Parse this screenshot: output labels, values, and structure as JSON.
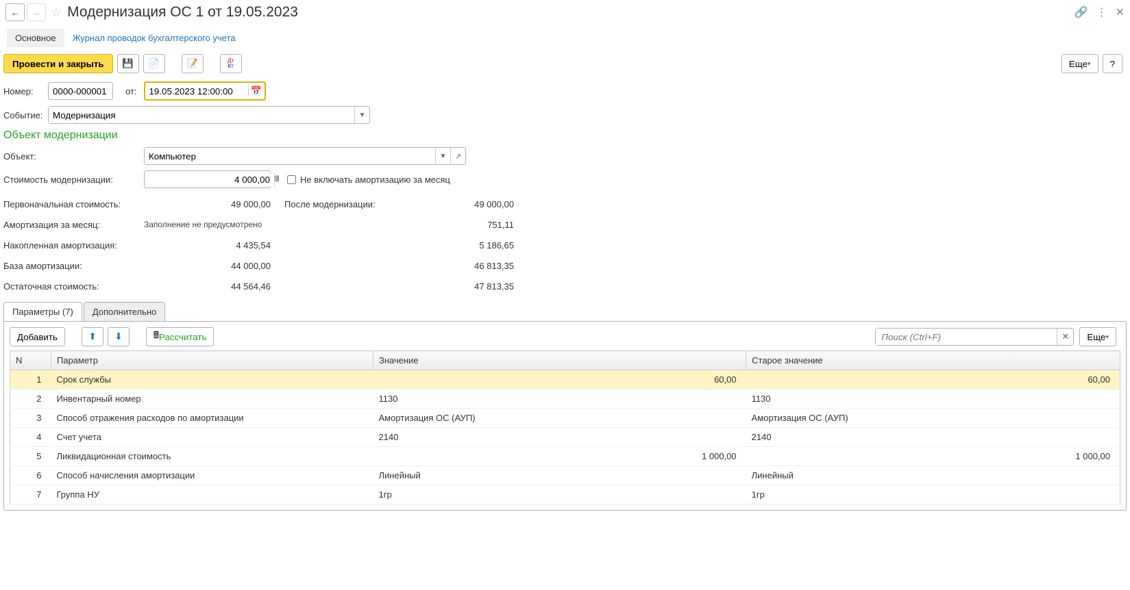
{
  "header": {
    "title": "Модернизация ОС 1 от 19.05.2023"
  },
  "nav": {
    "main": "Основное",
    "journal": "Журнал проводок бухгалтерского учета"
  },
  "toolbar": {
    "post_close": "Провести и закрыть",
    "more": "Еще",
    "help": "?"
  },
  "form": {
    "number_label": "Номер:",
    "number_value": "0000-000001",
    "from_label": "от:",
    "date_value": "19.05.2023 12:00:00",
    "event_label": "Событие:",
    "event_value": "Модернизация"
  },
  "section": {
    "title": "Объект модернизации",
    "object_label": "Объект:",
    "object_value": "Компьютер",
    "cost_label": "Стоимость модернизации:",
    "cost_value": "4 000,00",
    "exclude_amort": "Не включать амортизацию за месяц"
  },
  "grid": {
    "initial_cost_label": "Первоначальная стоимость:",
    "initial_cost_val": "49 000,00",
    "after_label": "После модернизации:",
    "after_initial_cost": "49 000,00",
    "amort_month_label": "Амортизация за месяц:",
    "amort_month_note": "Заполнение не предусмотрено",
    "amort_month_after": "751,11",
    "accum_amort_label": "Накопленная амортизация:",
    "accum_amort_val": "4 435,54",
    "accum_amort_after": "5 186,65",
    "base_label": "База амортизации:",
    "base_val": "44 000,00",
    "base_after": "46 813,35",
    "residual_label": "Остаточная стоимость:",
    "residual_val": "44 564,46",
    "residual_after": "47 813,35"
  },
  "tabs": {
    "params": "Параметры (7)",
    "extra": "Дополнительно"
  },
  "tab_toolbar": {
    "add": "Добавить",
    "calc": "Рассчитать",
    "search_placeholder": "Поиск (Ctrl+F)",
    "more": "Еще"
  },
  "table": {
    "headers": {
      "n": "N",
      "param": "Параметр",
      "value": "Значение",
      "old": "Старое значение"
    },
    "rows": [
      {
        "n": "1",
        "param": "Срок службы",
        "value": "60,00",
        "old": "60,00",
        "numeric": true,
        "selected": true
      },
      {
        "n": "2",
        "param": "Инвентарный номер",
        "value": "1130",
        "old": "1130"
      },
      {
        "n": "3",
        "param": "Способ отражения расходов по амортизации",
        "value": "Амортизация ОС (АУП)",
        "old": "Амортизация ОС (АУП)"
      },
      {
        "n": "4",
        "param": "Счет учета",
        "value": "2140",
        "old": "2140"
      },
      {
        "n": "5",
        "param": "Ликвидационная стоимость",
        "value": "1 000,00",
        "old": "1 000,00",
        "numeric": true
      },
      {
        "n": "6",
        "param": "Способ начисления амортизации",
        "value": "Линейный",
        "old": "Линейный"
      },
      {
        "n": "7",
        "param": "Группа НУ",
        "value": "1гр",
        "old": "1гр"
      }
    ]
  }
}
